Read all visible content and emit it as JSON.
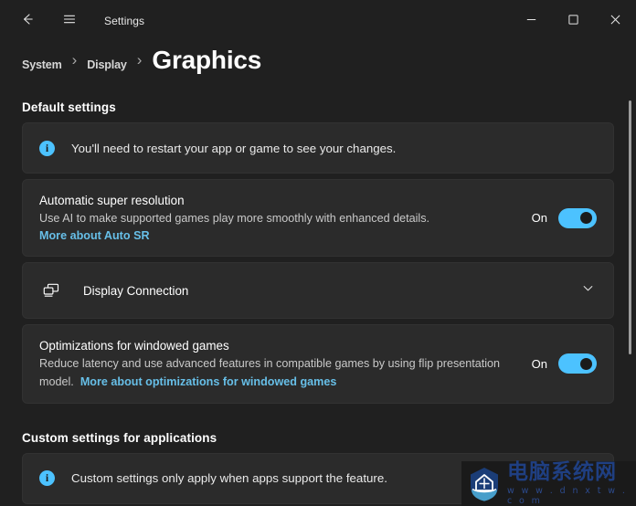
{
  "titlebar": {
    "back_icon": "back-arrow-icon",
    "menu_icon": "hamburger-menu-icon",
    "title": "Settings",
    "minimize_label": "–",
    "maximize_label": "□",
    "close_label": "✕"
  },
  "breadcrumb": {
    "items": [
      {
        "label": "System",
        "current": false
      },
      {
        "label": "Display",
        "current": false
      },
      {
        "label": "Graphics",
        "current": true
      }
    ],
    "separator": "›"
  },
  "sections": {
    "default_settings": {
      "heading": "Default settings",
      "banner": {
        "icon": "info-icon",
        "icon_glyph": "i",
        "text": "You'll need to restart your app or game to see your changes."
      },
      "auto_sr": {
        "title": "Automatic super resolution",
        "description": "Use AI to make supported games play more smoothly with enhanced details.",
        "link": "More about Auto SR",
        "toggle_label": "On",
        "toggle_state": "on"
      },
      "display_connection": {
        "icon": "multiple-displays-icon",
        "label": "Display Connection",
        "chevron": "chevron-down-icon"
      },
      "windowed_optimizations": {
        "title": "Optimizations for windowed games",
        "description": "Reduce latency and use advanced features in compatible games by using flip presentation model.",
        "link": "More about optimizations for windowed games",
        "toggle_label": "On",
        "toggle_state": "on"
      }
    },
    "custom_settings": {
      "heading": "Custom settings for applications",
      "banner": {
        "icon": "info-icon",
        "icon_glyph": "i",
        "text": "Custom settings only apply when apps support the feature."
      }
    }
  },
  "watermark": {
    "logo": "house-shield-logo",
    "name": "电脑系统网",
    "url": "w w w . d n x t w . c o m"
  },
  "colors": {
    "page_background": "#202020",
    "card_background": "#2b2b2b",
    "accent": "#4cc2ff",
    "link": "#67bfe8"
  }
}
